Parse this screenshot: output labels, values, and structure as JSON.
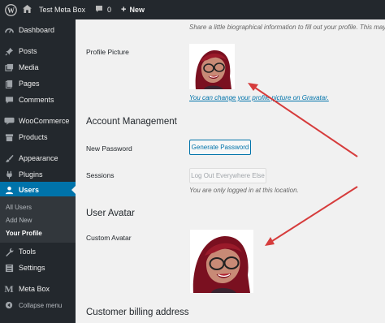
{
  "adminbar": {
    "site_name": "Test Meta Box",
    "comments_count": "0",
    "new_label": "New",
    "icons": [
      "wordpress-logo-icon",
      "home-icon",
      "comment-bubble-icon",
      "plus-icon"
    ]
  },
  "sidebar": {
    "items": [
      {
        "label": "Dashboard",
        "icon": "dashboard-icon"
      },
      {
        "label": "Posts",
        "icon": "pin-icon"
      },
      {
        "label": "Media",
        "icon": "media-icon"
      },
      {
        "label": "Pages",
        "icon": "pages-icon"
      },
      {
        "label": "Comments",
        "icon": "comment-bubble-icon"
      },
      {
        "label": "WooCommerce",
        "icon": "woocommerce-icon"
      },
      {
        "label": "Products",
        "icon": "archive-box-icon"
      },
      {
        "label": "Appearance",
        "icon": "paint-brush-icon"
      },
      {
        "label": "Plugins",
        "icon": "plug-icon"
      },
      {
        "label": "Users",
        "icon": "users-icon"
      },
      {
        "label": "Tools",
        "icon": "wrench-icon"
      },
      {
        "label": "Settings",
        "icon": "settings-sliders-icon"
      },
      {
        "label": "Meta Box",
        "icon": "meta-box-m-icon"
      },
      {
        "label": "Collapse menu",
        "icon": "collapse-circle-icon"
      }
    ],
    "users_submenu": [
      "All Users",
      "Add New",
      "Your Profile"
    ],
    "active_color": "#0073aa",
    "bg_color": "#23282d"
  },
  "profile": {
    "bio_description": "Share a little biographical information to fill out your profile. This may",
    "profile_picture_label": "Profile Picture",
    "gravatar_link": "You can change your profile picture on Gravatar.",
    "account_heading": "Account Management",
    "new_password_label": "New Password",
    "generate_password_button": "Generate Password",
    "sessions_label": "Sessions",
    "logout_everywhere_button": "Log Out Everywhere Else",
    "sessions_description": "You are only logged in at this location.",
    "user_avatar_heading": "User Avatar",
    "custom_avatar_label": "Custom Avatar",
    "billing_heading": "Customer billing address"
  },
  "annotation_color": "#d63c3c"
}
